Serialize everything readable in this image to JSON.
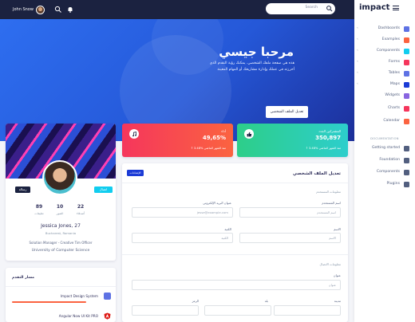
{
  "topnav": {
    "user_name": "John Snow",
    "search_placeholder": "Search",
    "icons": [
      "search-icon",
      "bell-icon",
      "search-icon"
    ]
  },
  "hero": {
    "title": "مرحبا جيسي",
    "text": "هذه هي صفحة ملفك الشخصي. يمكنك رؤية التقدم الذي أحرزته في عملك وإدارة مشاريعك أو المهام المعينة",
    "button": "تعديل الملف الشخصي"
  },
  "profile": {
    "connect": "اتصال",
    "message": "رسالة",
    "stats": [
      {
        "value": "22",
        "label": "أصدقاء"
      },
      {
        "value": "10",
        "label": "الصور"
      },
      {
        "value": "89",
        "label": "تعليقات"
      }
    ],
    "name": "Jessica Jones, 27",
    "location": "Bucharest, Romania",
    "job": "Solution Manager - Creative Tim Officer",
    "university": "University of Computer Science"
  },
  "track": {
    "title": "مسار التقدم",
    "items": [
      {
        "name": "Impact Design System",
        "progress": 0.75,
        "color": "#fb6340",
        "logo_color": "#5e72e4"
      },
      {
        "name": "Angular Now UI Kit PRO",
        "progress": 0.6,
        "color": "#2dce89",
        "logo_color": "#f5365c"
      }
    ]
  },
  "stat_cards": [
    {
      "title": "أداء",
      "value": "49,65%",
      "change": "3.48% منذ الشهر الماضي",
      "icon": "music-note-icon",
      "accent": "#f5365c"
    },
    {
      "title": "المشتركين الجدد",
      "value": "350,897",
      "change": "3.48% منذ الشهر الماضي",
      "icon": "thumbs-up-icon",
      "accent": "#2dce89"
    }
  ],
  "form": {
    "title": "تعديل الملف الشخصي",
    "settings_btn": "الإعدادات",
    "section_user": "معلومات المستخدم",
    "section_contact": "معلومات الاتصال",
    "username_label": "اسم المستخدم",
    "username_value": "اسم المستخدم",
    "email_label": "عنوان البريد الإلكتروني",
    "email_value": "jesse@example.com",
    "firstname_label": "الاسم",
    "firstname_value": "الاسم",
    "lastname_label": "الكنية",
    "lastname_value": "الكنية",
    "address_label": "عنوان",
    "address_value": "عنوان",
    "city_label": "مدينة",
    "country_label": "بلد",
    "postal_label": "الرمز"
  },
  "sidebar": {
    "brand": "impact",
    "items": [
      {
        "label": "Dashboards",
        "color": "#5e72e4",
        "chevron": true
      },
      {
        "label": "Examples",
        "color": "#fb6340",
        "chevron": true
      },
      {
        "label": "Components",
        "color": "#11cdef",
        "chevron": true
      },
      {
        "label": "Forms",
        "color": "#f5365c",
        "chevron": true
      },
      {
        "label": "Tables",
        "color": "#5e72e4",
        "chevron": true
      },
      {
        "label": "Maps",
        "color": "#1b3bd6",
        "chevron": true
      },
      {
        "label": "Widgets",
        "color": "#8965e0",
        "chevron": false
      },
      {
        "label": "Charts",
        "color": "#f5365c",
        "chevron": false
      },
      {
        "label": "Calendar",
        "color": "#fb6340",
        "chevron": false
      }
    ],
    "section": "DOCUMENTATION",
    "docs": [
      {
        "label": "Getting started",
        "color": "#525f7f"
      },
      {
        "label": "Foundation",
        "color": "#525f7f"
      },
      {
        "label": "Components",
        "color": "#525f7f"
      },
      {
        "label": "Plugins",
        "color": "#525f7f"
      }
    ]
  }
}
